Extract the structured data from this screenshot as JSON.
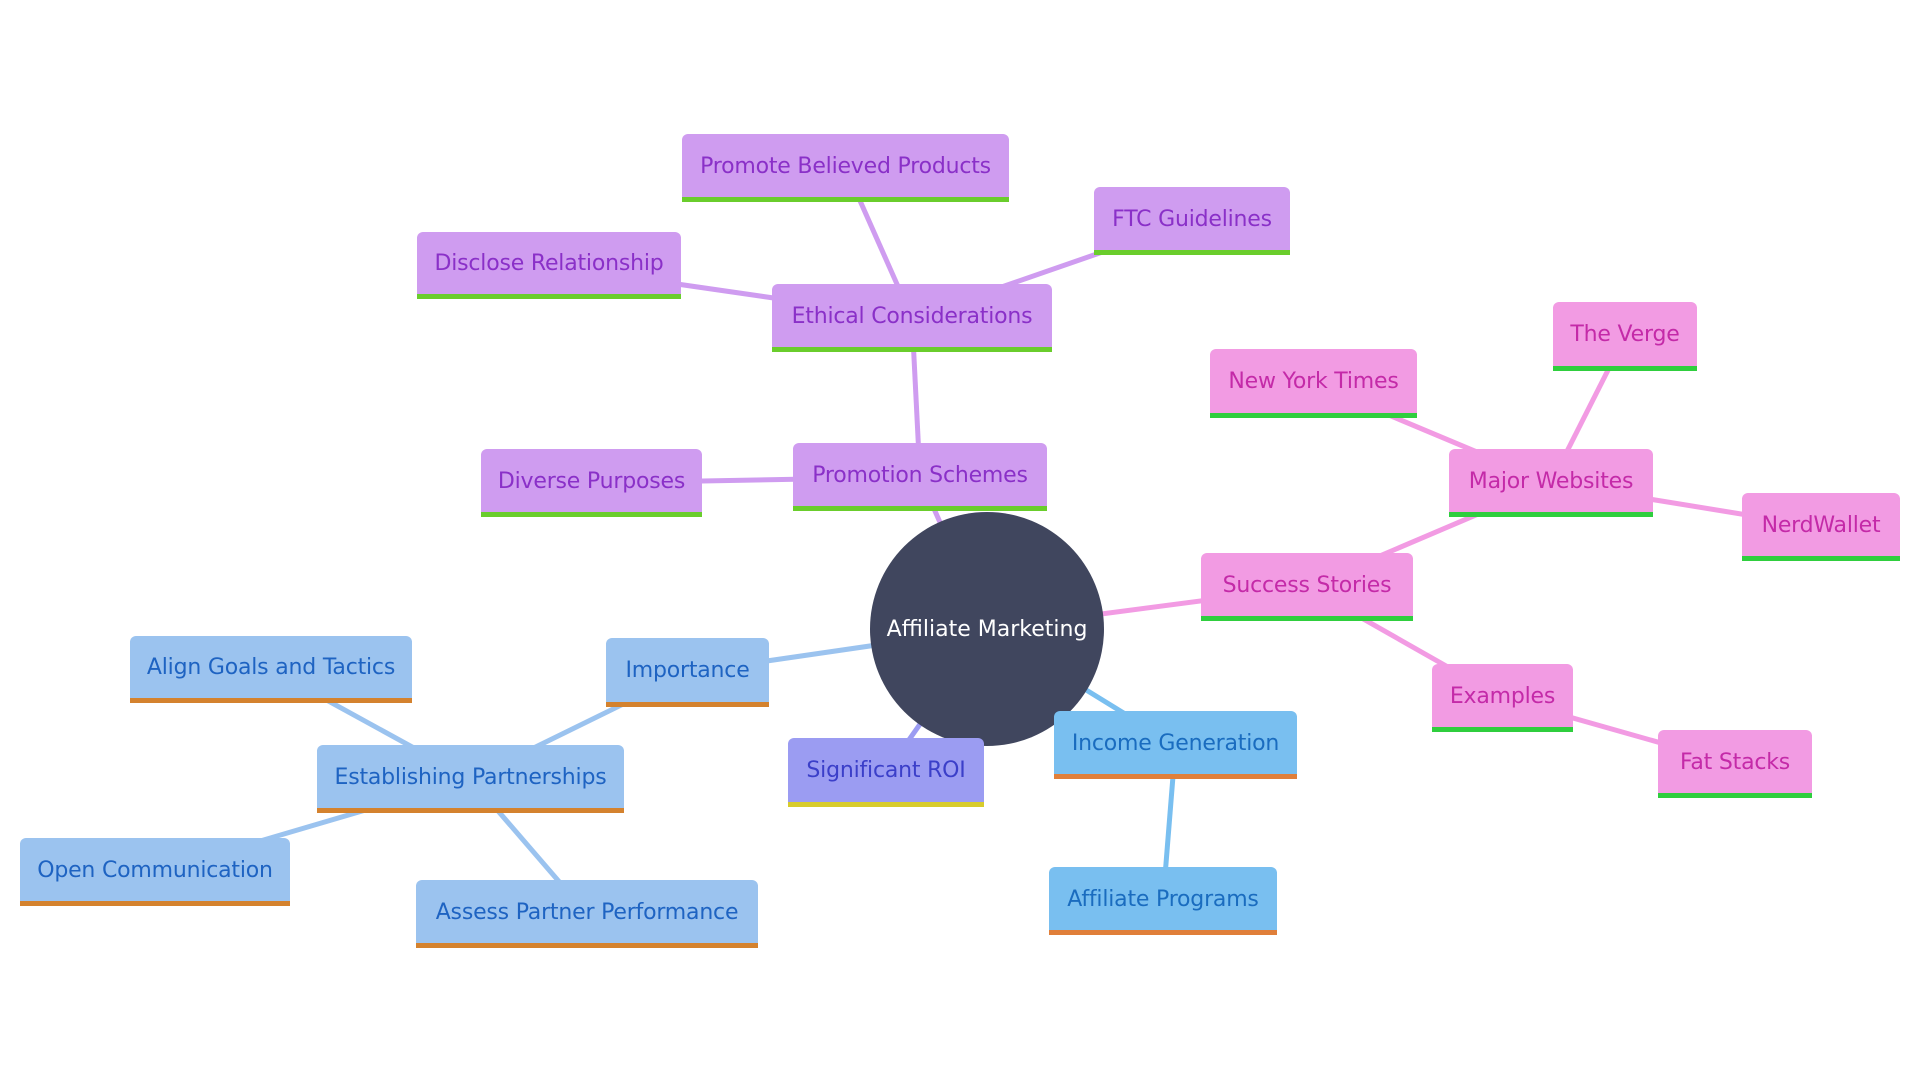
{
  "diagram": {
    "type": "mindmap",
    "root": {
      "id": "root",
      "label": "Affiliate Marketing",
      "color": "#40465e",
      "text_color": "#ffffff"
    },
    "branch_styles": {
      "ethics": {
        "fill": "#cf9cf0",
        "text": "#8a30c8",
        "stripe": "#6acd2c",
        "edge": "#cf9cf0"
      },
      "success": {
        "fill": "#f29be3",
        "text": "#c42aa8",
        "stripe": "#2fce3e",
        "edge": "#f29be3"
      },
      "income": {
        "fill": "#79bff0",
        "text": "#1a6cbf",
        "stripe": "#e07f3a",
        "edge": "#79bff0"
      },
      "importance": {
        "fill": "#9bc3ef",
        "text": "#1e63c2",
        "stripe": "#d4822e",
        "edge": "#9bc3ef"
      },
      "roi": {
        "fill": "#9b9cf2",
        "text": "#3b3fc9",
        "stripe": "#d8cc2c",
        "edge": "#9b9cf2"
      }
    },
    "nodes": [
      {
        "id": "promotion-schemes",
        "label": "Promotion Schemes",
        "parent": "root",
        "branch": "ethics"
      },
      {
        "id": "ethical-considerations",
        "label": "Ethical Considerations",
        "parent": "promotion-schemes",
        "branch": "ethics"
      },
      {
        "id": "promote-believed-products",
        "label": "Promote Believed Products",
        "parent": "ethical-considerations",
        "branch": "ethics"
      },
      {
        "id": "ftc-guidelines",
        "label": "FTC Guidelines",
        "parent": "ethical-considerations",
        "branch": "ethics"
      },
      {
        "id": "disclose-relationship",
        "label": "Disclose Relationship",
        "parent": "ethical-considerations",
        "branch": "ethics"
      },
      {
        "id": "diverse-purposes",
        "label": "Diverse Purposes",
        "parent": "promotion-schemes",
        "branch": "ethics"
      },
      {
        "id": "success-stories",
        "label": "Success Stories",
        "parent": "root",
        "branch": "success"
      },
      {
        "id": "major-websites",
        "label": "Major Websites",
        "parent": "success-stories",
        "branch": "success"
      },
      {
        "id": "new-york-times",
        "label": "New York Times",
        "parent": "major-websites",
        "branch": "success"
      },
      {
        "id": "the-verge",
        "label": "The Verge",
        "parent": "major-websites",
        "branch": "success"
      },
      {
        "id": "nerdwallet",
        "label": "NerdWallet",
        "parent": "major-websites",
        "branch": "success"
      },
      {
        "id": "examples",
        "label": "Examples",
        "parent": "success-stories",
        "branch": "success"
      },
      {
        "id": "fat-stacks",
        "label": "Fat Stacks",
        "parent": "examples",
        "branch": "success"
      },
      {
        "id": "income-generation",
        "label": "Income Generation",
        "parent": "root",
        "branch": "income"
      },
      {
        "id": "affiliate-programs",
        "label": "Affiliate Programs",
        "parent": "income-generation",
        "branch": "income"
      },
      {
        "id": "significant-roi",
        "label": "Significant ROI",
        "parent": "root",
        "branch": "roi"
      },
      {
        "id": "importance",
        "label": "Importance",
        "parent": "root",
        "branch": "importance"
      },
      {
        "id": "establishing-partnerships",
        "label": "Establishing Partnerships",
        "parent": "importance",
        "branch": "importance"
      },
      {
        "id": "align-goals-and-tactics",
        "label": "Align Goals and Tactics",
        "parent": "establishing-partnerships",
        "branch": "importance"
      },
      {
        "id": "open-communication",
        "label": "Open Communication",
        "parent": "establishing-partnerships",
        "branch": "importance"
      },
      {
        "id": "assess-partner-performance",
        "label": "Assess Partner Performance",
        "parent": "establishing-partnerships",
        "branch": "importance"
      }
    ]
  }
}
